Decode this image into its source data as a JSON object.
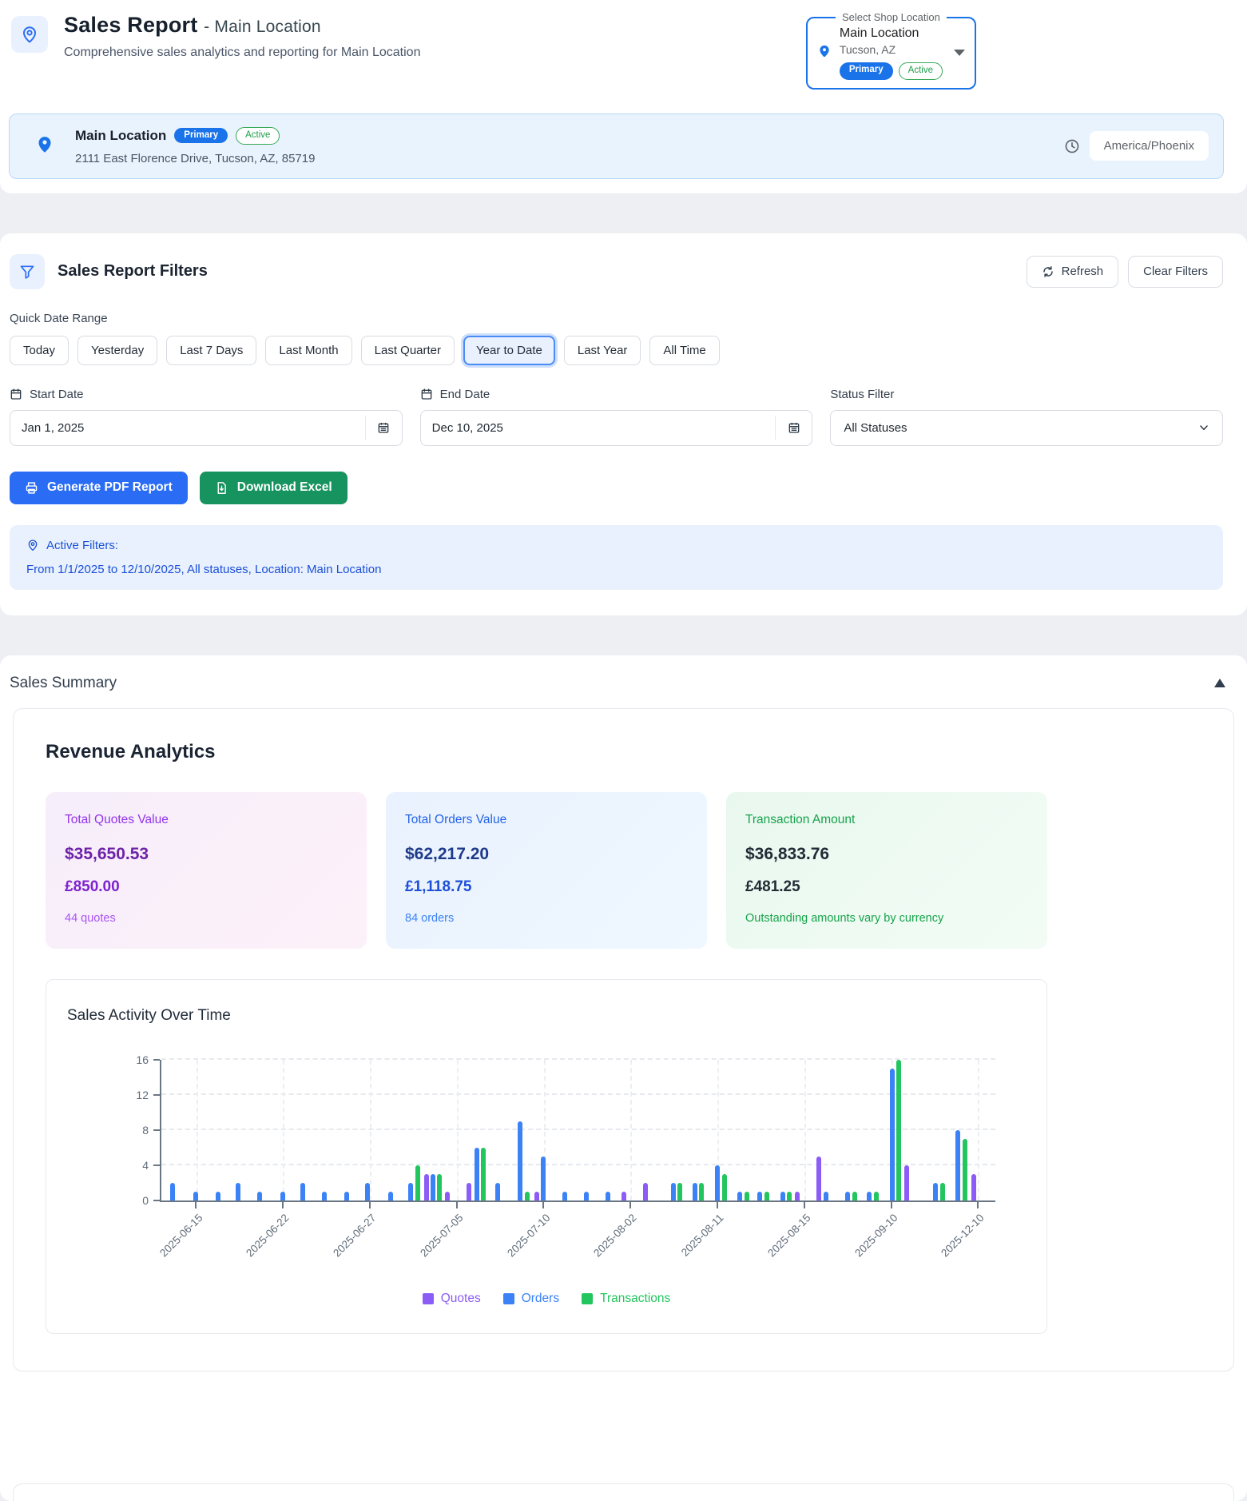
{
  "header": {
    "title": "Sales Report",
    "title_suffix": "- Main Location",
    "subtitle": "Comprehensive sales analytics and reporting for Main Location",
    "shop_selector": {
      "legend": "Select Shop Location",
      "name": "Main Location",
      "city": "Tucson, AZ",
      "primary_badge": "Primary",
      "active_badge": "Active"
    },
    "location_banner": {
      "name": "Main Location",
      "primary_badge": "Primary",
      "active_badge": "Active",
      "address": "2111 East Florence Drive, Tucson, AZ, 85719",
      "timezone": "America/Phoenix"
    }
  },
  "filters": {
    "title": "Sales Report Filters",
    "refresh_label": "Refresh",
    "clear_label": "Clear Filters",
    "quick_range_label": "Quick Date Range",
    "quick_ranges": [
      "Today",
      "Yesterday",
      "Last 7 Days",
      "Last Month",
      "Last Quarter",
      "Year to Date",
      "Last Year",
      "All Time"
    ],
    "selected_range": "Year to Date",
    "start_date": {
      "label": "Start Date",
      "value": "Jan 1, 2025"
    },
    "end_date": {
      "label": "End Date",
      "value": "Dec 10, 2025"
    },
    "status": {
      "label": "Status Filter",
      "value": "All Statuses"
    },
    "pdf_button": "Generate PDF Report",
    "excel_button": "Download Excel",
    "active_filters": {
      "title": "Active Filters:",
      "summary": "From 1/1/2025 to 12/10/2025, All statuses, Location: Main Location"
    }
  },
  "summary": {
    "section_title": "Sales Summary",
    "revenue_title": "Revenue Analytics",
    "stats": [
      {
        "label": "Total Quotes Value",
        "usd": "$35,650.53",
        "gbp": "£850.00",
        "note": "44 quotes",
        "theme": "purple"
      },
      {
        "label": "Total Orders Value",
        "usd": "$62,217.20",
        "gbp": "£1,118.75",
        "note": "84 orders",
        "theme": "blue"
      },
      {
        "label": "Transaction Amount",
        "usd": "$36,833.76",
        "gbp": "£481.25",
        "note": "Outstanding amounts vary by currency",
        "theme": "green"
      }
    ]
  },
  "chart_data": {
    "type": "bar",
    "title": "Sales Activity Over Time",
    "x_tick_labels": [
      "2025-06-15",
      "2025-06-22",
      "2025-06-27",
      "2025-07-05",
      "2025-07-10",
      "2025-08-02",
      "2025-08-11",
      "2025-08-15",
      "2025-09-10",
      "2025-12-10"
    ],
    "y_ticks": [
      0,
      4,
      8,
      12,
      16
    ],
    "ylim": [
      0,
      16
    ],
    "axis_domain": [
      -0.4,
      9.2
    ],
    "grid": "dashed",
    "legend_position": "bottom",
    "series_colors": {
      "quotes": "#8b5cf6",
      "orders": "#3b82f6",
      "transactions": "#22c55e"
    },
    "legend": [
      {
        "label": "Quotes",
        "series": "quotes"
      },
      {
        "label": "Orders",
        "series": "orders"
      },
      {
        "label": "Transactions",
        "series": "transactions"
      }
    ],
    "bars": [
      {
        "t": -0.27,
        "s": "orders",
        "v": 2
      },
      {
        "t": 0.0,
        "s": "orders",
        "v": 1
      },
      {
        "t": 0.25,
        "s": "orders",
        "v": 1
      },
      {
        "t": 0.48,
        "s": "orders",
        "v": 2
      },
      {
        "t": 0.73,
        "s": "orders",
        "v": 1
      },
      {
        "t": 1.0,
        "s": "orders",
        "v": 1
      },
      {
        "t": 1.23,
        "s": "orders",
        "v": 2
      },
      {
        "t": 1.48,
        "s": "orders",
        "v": 1
      },
      {
        "t": 1.73,
        "s": "orders",
        "v": 1
      },
      {
        "t": 1.97,
        "s": "orders",
        "v": 2
      },
      {
        "t": 2.24,
        "s": "orders",
        "v": 1
      },
      {
        "t": 2.47,
        "s": "orders",
        "v": 2
      },
      {
        "t": 2.55,
        "s": "transactions",
        "v": 4
      },
      {
        "t": 2.65,
        "s": "quotes",
        "v": 3
      },
      {
        "t": 2.73,
        "s": "orders",
        "v": 3
      },
      {
        "t": 2.8,
        "s": "transactions",
        "v": 3
      },
      {
        "t": 2.89,
        "s": "quotes",
        "v": 1
      },
      {
        "t": 3.14,
        "s": "quotes",
        "v": 2
      },
      {
        "t": 3.23,
        "s": "orders",
        "v": 6
      },
      {
        "t": 3.31,
        "s": "transactions",
        "v": 6
      },
      {
        "t": 3.47,
        "s": "orders",
        "v": 2
      },
      {
        "t": 3.73,
        "s": "orders",
        "v": 9
      },
      {
        "t": 3.81,
        "s": "transactions",
        "v": 1
      },
      {
        "t": 3.92,
        "s": "quotes",
        "v": 1
      },
      {
        "t": 4.0,
        "s": "orders",
        "v": 5
      },
      {
        "t": 4.24,
        "s": "orders",
        "v": 1
      },
      {
        "t": 4.49,
        "s": "orders",
        "v": 1
      },
      {
        "t": 4.74,
        "s": "orders",
        "v": 1
      },
      {
        "t": 4.92,
        "s": "quotes",
        "v": 1
      },
      {
        "t": 5.17,
        "s": "quotes",
        "v": 2
      },
      {
        "t": 5.49,
        "s": "orders",
        "v": 2
      },
      {
        "t": 5.57,
        "s": "transactions",
        "v": 2
      },
      {
        "t": 5.74,
        "s": "orders",
        "v": 2
      },
      {
        "t": 5.82,
        "s": "transactions",
        "v": 2
      },
      {
        "t": 6.0,
        "s": "orders",
        "v": 4
      },
      {
        "t": 6.08,
        "s": "transactions",
        "v": 3
      },
      {
        "t": 6.26,
        "s": "orders",
        "v": 1
      },
      {
        "t": 6.34,
        "s": "transactions",
        "v": 1
      },
      {
        "t": 6.49,
        "s": "orders",
        "v": 1
      },
      {
        "t": 6.57,
        "s": "transactions",
        "v": 1
      },
      {
        "t": 6.75,
        "s": "orders",
        "v": 1
      },
      {
        "t": 6.83,
        "s": "transactions",
        "v": 1
      },
      {
        "t": 6.92,
        "s": "quotes",
        "v": 1
      },
      {
        "t": 7.17,
        "s": "quotes",
        "v": 5
      },
      {
        "t": 7.25,
        "s": "orders",
        "v": 1
      },
      {
        "t": 7.5,
        "s": "orders",
        "v": 1
      },
      {
        "t": 7.58,
        "s": "transactions",
        "v": 1
      },
      {
        "t": 7.75,
        "s": "orders",
        "v": 1
      },
      {
        "t": 7.83,
        "s": "transactions",
        "v": 1
      },
      {
        "t": 8.01,
        "s": "orders",
        "v": 15
      },
      {
        "t": 8.09,
        "s": "transactions",
        "v": 16
      },
      {
        "t": 8.18,
        "s": "quotes",
        "v": 4
      },
      {
        "t": 8.51,
        "s": "orders",
        "v": 2
      },
      {
        "t": 8.59,
        "s": "transactions",
        "v": 2
      },
      {
        "t": 8.77,
        "s": "orders",
        "v": 8
      },
      {
        "t": 8.85,
        "s": "transactions",
        "v": 7
      },
      {
        "t": 8.95,
        "s": "quotes",
        "v": 3
      }
    ]
  },
  "colors": {
    "accent_blue": "#1a73e8",
    "button_blue": "#2a6df4",
    "button_green": "#17935f",
    "banner_bg": "#e9f3fe",
    "active_filter_text": "#1c4fd7"
  }
}
